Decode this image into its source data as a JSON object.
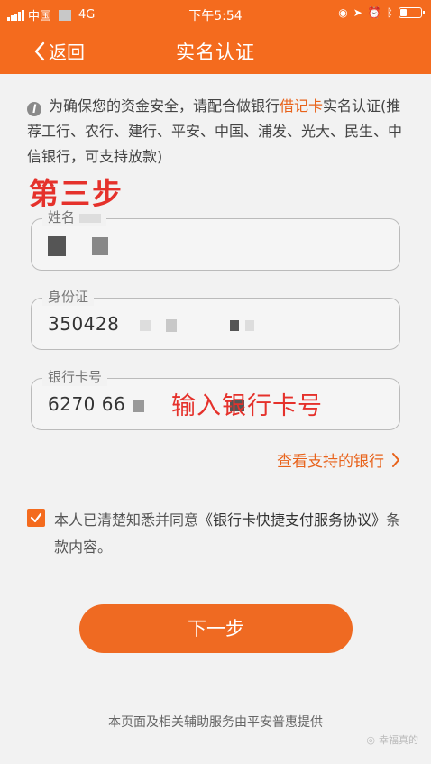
{
  "status_bar": {
    "carrier": "中国",
    "network": "4G",
    "time": "下午5:54",
    "battery_level": 0.3
  },
  "nav": {
    "back_label": "返回",
    "title": "实名认证"
  },
  "notice": {
    "icon": "info-icon",
    "text_before": "为确保您的资金安全，请配合做银行",
    "highlight": "借记卡",
    "text_after": "实名认证(推荐工行、农行、建行、平安、中国、浦发、光大、民生、中信银行，可支持放款)"
  },
  "step_annotation": "第三步",
  "form": {
    "name": {
      "label": "姓名",
      "value": ""
    },
    "id_card": {
      "label": "身份证",
      "value": "350428"
    },
    "bank_card": {
      "label": "银行卡号",
      "value": "6270 66"
    }
  },
  "input_annotation": "输入银行卡号",
  "supported_banks_link": "查看支持的银行",
  "agreement": {
    "checked": true,
    "text_before": "本人已清楚知悉并同意",
    "link": "《银行卡快捷支付服务协议》",
    "text_after": "条款内容。"
  },
  "next_button": "下一步",
  "footer": "本页面及相关辅助服务由平安普惠提供",
  "watermark": "幸福真的",
  "colors": {
    "brand": "#f46b1e",
    "annotation": "#e5312b"
  }
}
